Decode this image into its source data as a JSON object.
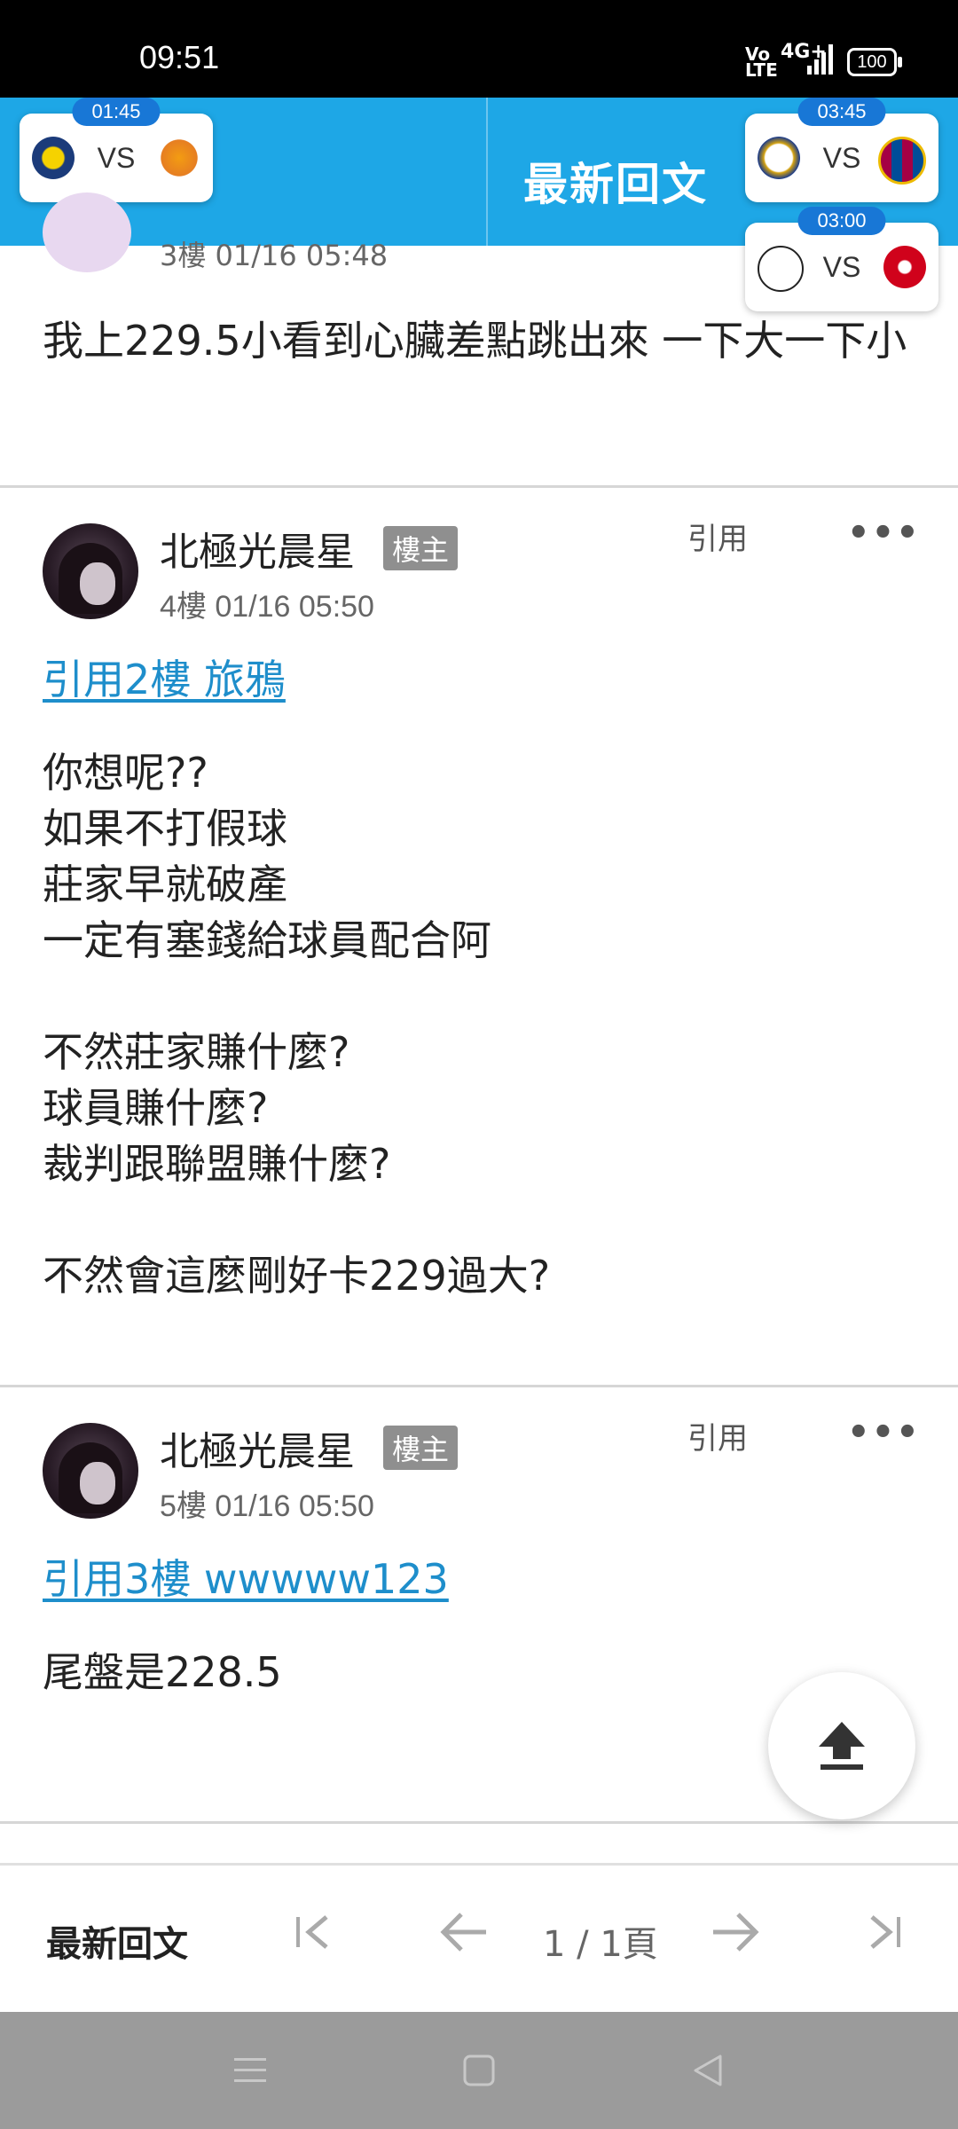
{
  "status_bar": {
    "time": "09:51",
    "signal_tag": "Vo\nLTE",
    "network": "4G+",
    "battery": "100"
  },
  "header": {
    "title": "最新回文",
    "matches": [
      {
        "time": "01:45",
        "vs": "VS",
        "home_color": "#1b3b7a",
        "away_color": "#f39c12"
      },
      {
        "time": "03:45",
        "vs": "VS",
        "home_color": "#d4a20f",
        "away_color": "#a50044"
      },
      {
        "time": "03:00",
        "vs": "VS",
        "home_color": "#222222",
        "away_color": "#d0021b"
      }
    ]
  },
  "posts": [
    {
      "floor_meta": "3樓  01/16 05:48",
      "body": "我上229.5小看到心臟差點跳出來 一下大一下小"
    },
    {
      "author": "北極光晨星",
      "badge": "樓主",
      "floor_meta": "4樓  01/16 05:50",
      "quote_label": "引用",
      "more": "•••",
      "reference": "引用2樓 旅鴉",
      "body": "你想呢??\n如果不打假球\n莊家早就破產\n一定有塞錢給球員配合阿\n\n不然莊家賺什麼?\n球員賺什麼?\n裁判跟聯盟賺什麼?\n\n不然會這麼剛好卡229過大?"
    },
    {
      "author": "北極光晨星",
      "badge": "樓主",
      "floor_meta": "5樓  01/16 05:50",
      "quote_label": "引用",
      "more": "•••",
      "reference": "引用3樓 wwwww123",
      "body": "尾盤是228.5"
    }
  ],
  "bottom_bar": {
    "label": "最新回文",
    "page": "1 / 1頁"
  },
  "colors": {
    "accent": "#1ea7e6",
    "link": "#1e8ecb",
    "badge": "#8f8f8f"
  }
}
